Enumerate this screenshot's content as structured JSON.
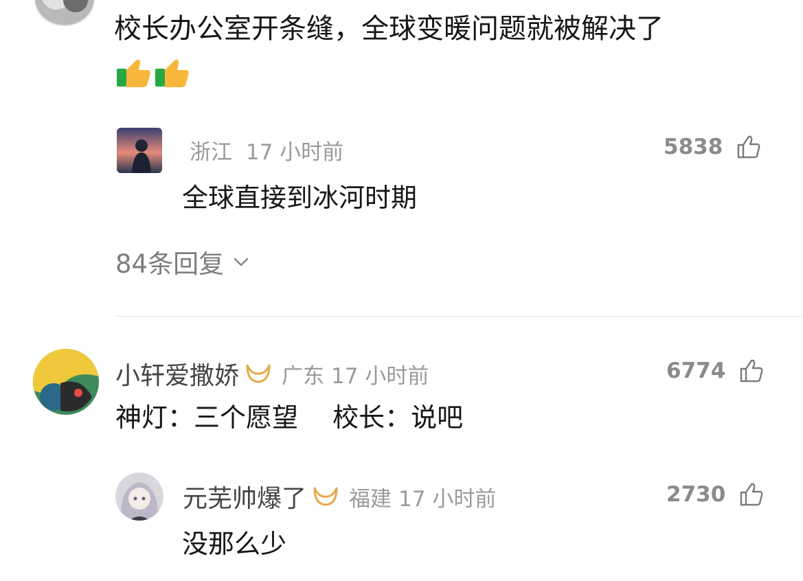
{
  "top_comment": {
    "text": "校长办公室开条缝，全球变暖问题就被解决了",
    "emoji": "👍👍"
  },
  "reply_1": {
    "location": "浙江",
    "time": "17 小时前",
    "likes": "5838",
    "text": "全球直接到冰河时期"
  },
  "replies_toggle": {
    "label": "84条回复",
    "icon": "chevron-down-icon"
  },
  "comment_2": {
    "username": "小轩爱撒娇",
    "location": "广东",
    "time": "17 小时前",
    "likes": "6774",
    "text": "神灯：三个愿望　 校长：说吧"
  },
  "reply_2": {
    "username": "元芜帅爆了",
    "location": "福建",
    "time": "17 小时前",
    "likes": "2730",
    "text": "没那么少"
  },
  "colors": {
    "badge": "#e8a84a",
    "meta": "#9a9a9a",
    "text": "#161616"
  }
}
